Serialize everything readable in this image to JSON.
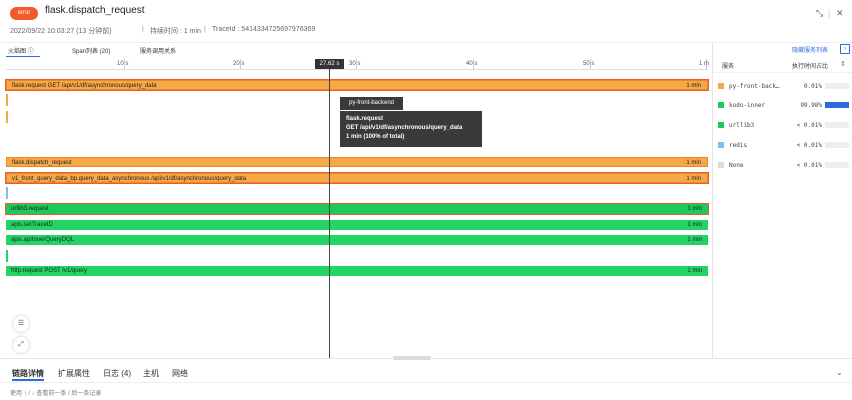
{
  "header": {
    "badge": "error",
    "title": "flask.dispatch_request",
    "date": "2022/09/22 10:03:27 (13 分钟前)",
    "duration": "持续时间 : 1 min",
    "trace": "TraceId : 5414334725697976369"
  },
  "tabs": [
    "火焰图 ⓘ",
    "Span列表 (20)",
    "服务调用关系"
  ],
  "ruler": {
    "ticks": [
      "10 s",
      "20 s",
      "30 s",
      "40 s",
      "50 s",
      "1 m"
    ],
    "cursor": "27.62 s"
  },
  "bars": [
    {
      "label": "flask.request GET /api/v1/df/asynchronous/query_data",
      "dur": "1 min"
    },
    {
      "label": "flask.dispatch_request",
      "dur": "1 min"
    },
    {
      "label": "v1_front_query_data_bp.query_data_asynchronous /api/v1/df/asynchronous/query_data",
      "dur": "1 min"
    },
    {
      "label": "urllib3.request",
      "dur": "1 min"
    },
    {
      "label": "apis.setTraceID",
      "dur": "1 min"
    },
    {
      "label": "apis.apiInnerQueryDQL",
      "dur": "1 min"
    },
    {
      "label": "http.request POST /v1/query",
      "dur": "1 min"
    }
  ],
  "tooltip": {
    "service": "py-front-backend",
    "line1": "flask.request",
    "line2": "GET /api/v1/df/asynchronous/query_data",
    "line3": "1 min (100% of total)"
  },
  "panel": {
    "link": "隐藏服务列表",
    "col_service": "服务",
    "col_pct": "执行时间占比",
    "services": [
      {
        "name": "py-front-back…",
        "pct": "0.01%",
        "color": "#f7a846",
        "share": 0.0001
      },
      {
        "name": "kodo-inner",
        "pct": "99.98%",
        "color": "#1dc95a",
        "share": 0.9998
      },
      {
        "name": "urllib3",
        "pct": "< 0.01%",
        "color": "#1dc95a",
        "share": 0.0
      },
      {
        "name": "redis",
        "pct": "< 0.01%",
        "color": "#7cc0ef",
        "share": 0.0
      },
      {
        "name": "None",
        "pct": "< 0.01%",
        "color": "#dcdcdc",
        "share": 0.0
      }
    ]
  },
  "bottom_tabs": [
    "链路详情",
    "扩展属性",
    "日志 (4)",
    "主机",
    "网络"
  ],
  "hint": "使用 ↑ / ↓ 查看前一条 / 后一条记录",
  "colors": {
    "accent": "#2f6be0",
    "error": "#f35a2a",
    "orange": "#f7a846",
    "green": "#1dc95a"
  }
}
